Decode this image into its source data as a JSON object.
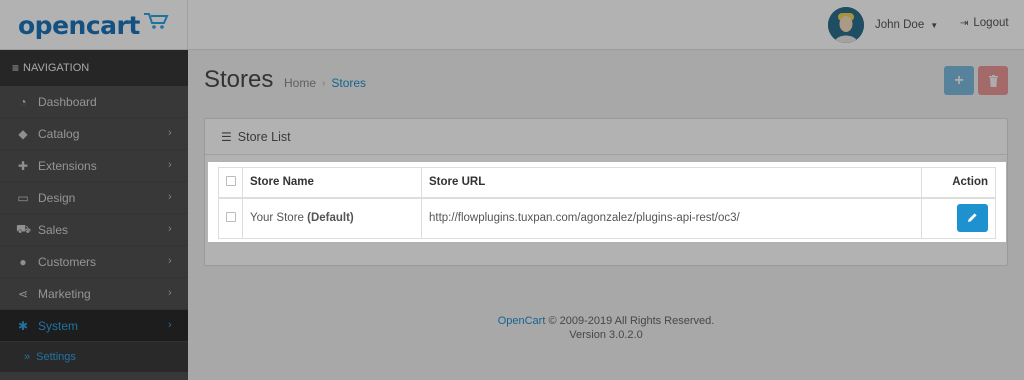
{
  "header": {
    "logo_text": "opencart",
    "user_name": "John Doe",
    "logout_label": "Logout"
  },
  "sidebar": {
    "title": "NAVIGATION",
    "items": [
      {
        "label": "Dashboard",
        "icon": "dashboard-icon"
      },
      {
        "label": "Catalog",
        "icon": "tags-icon"
      },
      {
        "label": "Extensions",
        "icon": "puzzle-icon"
      },
      {
        "label": "Design",
        "icon": "monitor-icon"
      },
      {
        "label": "Sales",
        "icon": "shopping-cart-icon"
      },
      {
        "label": "Customers",
        "icon": "user-icon"
      },
      {
        "label": "Marketing",
        "icon": "share-icon"
      },
      {
        "label": "System",
        "icon": "cog-icon"
      }
    ],
    "sub_item": "Settings"
  },
  "page": {
    "title": "Stores",
    "breadcrumb_home": "Home",
    "breadcrumb_sep": "›",
    "breadcrumb_current": "Stores",
    "add_icon": "+",
    "panel_title": "Store List"
  },
  "table": {
    "headers": {
      "name": "Store Name",
      "url": "Store URL",
      "action": "Action"
    },
    "rows": [
      {
        "name": "Your Store",
        "default_tag": "(Default)",
        "url": "http://flowplugins.tuxpan.com/agonzalez/plugins-api-rest/oc3/"
      }
    ]
  },
  "footer": {
    "link": "OpenCart",
    "copyright": " © 2009-2019 All Rights Reserved.",
    "version": "Version 3.0.2.0"
  },
  "colors": {
    "brand": "#1e91cf",
    "danger": "#e52b2b",
    "sidebar": "#515151"
  }
}
